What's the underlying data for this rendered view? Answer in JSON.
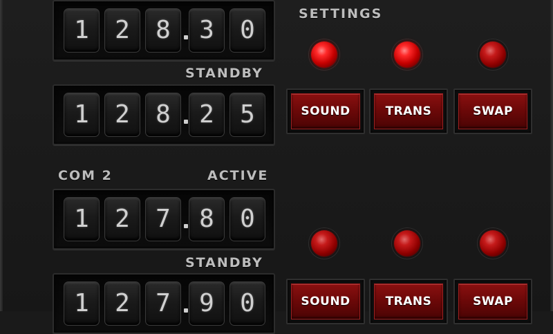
{
  "com1": {
    "active": {
      "digits": [
        "1",
        "2",
        "8",
        "3",
        "0"
      ]
    },
    "standby_label": "STANDBY",
    "standby": {
      "digits": [
        "1",
        "2",
        "8",
        "2",
        "5"
      ]
    }
  },
  "settings_label": "SETTINGS",
  "controls_top": {
    "leds": [
      "on",
      "on",
      "on"
    ],
    "buttons": [
      "SOUND",
      "TRANS",
      "SWAP"
    ]
  },
  "com2": {
    "title": "COM 2",
    "active_label": "ACTIVE",
    "active": {
      "digits": [
        "1",
        "2",
        "7",
        "8",
        "0"
      ]
    },
    "standby_label": "STANDBY",
    "standby": {
      "digits": [
        "1",
        "2",
        "7",
        "9",
        "0"
      ]
    }
  },
  "controls_bottom": {
    "leds": [
      "on",
      "on",
      "on"
    ],
    "buttons": [
      "SOUND",
      "TRANS",
      "SWAP"
    ]
  },
  "colors": {
    "panel": "#1a1a1a",
    "label": "#bdbdbd",
    "led": "#ff2a2a",
    "button": "#7a0c0c"
  }
}
